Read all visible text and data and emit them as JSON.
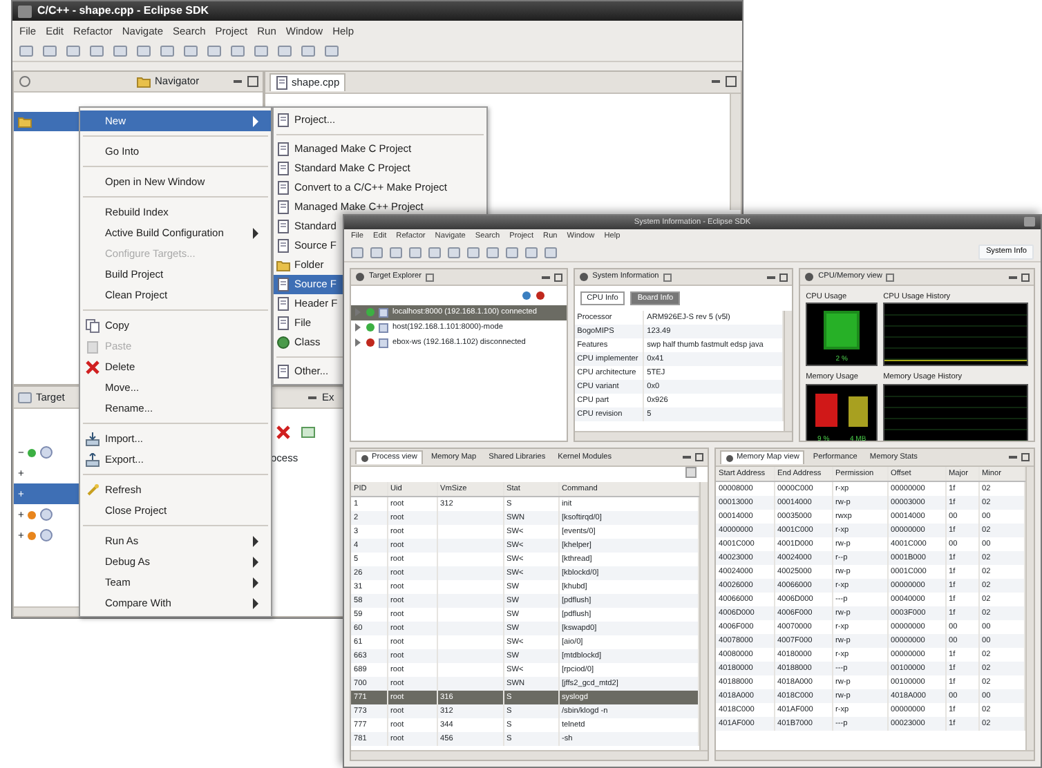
{
  "back_window": {
    "title": "C/C++ - shape.cpp - Eclipse SDK",
    "menu": [
      "File",
      "Edit",
      "Refactor",
      "Navigate",
      "Search",
      "Project",
      "Run",
      "Window",
      "Help"
    ],
    "navigator_tab": "Navigator",
    "editor_tab": "shape.cpp",
    "target_tab": "Target",
    "target_rows": [
      {
        "toggle": "−",
        "color": "#3cb043",
        "selected": false
      },
      {
        "toggle": "+",
        "selected": false
      },
      {
        "toggle": "+",
        "selected": true
      },
      {
        "toggle": "+",
        "color": "#e8851c",
        "selected": false
      },
      {
        "toggle": "+",
        "color": "#e8851c",
        "selected": false
      }
    ],
    "lower_tab": "Ex",
    "lower_text": "ocess"
  },
  "context_menu": [
    {
      "label": "New",
      "kind": "submenu",
      "selected": true,
      "disabled": false
    },
    {
      "kind": "separator"
    },
    {
      "label": "Go Into",
      "kind": "item",
      "selected": false,
      "disabled": false
    },
    {
      "kind": "separator"
    },
    {
      "label": "Open in New Window",
      "kind": "item",
      "selected": false,
      "disabled": false
    },
    {
      "kind": "separator"
    },
    {
      "label": "Rebuild Index",
      "kind": "item",
      "selected": false,
      "disabled": false
    },
    {
      "label": "Active Build Configuration",
      "kind": "submenu",
      "selected": false,
      "disabled": false
    },
    {
      "label": "Configure Targets...",
      "kind": "item",
      "selected": false,
      "disabled": true
    },
    {
      "label": "Build Project",
      "kind": "item",
      "selected": false,
      "disabled": false
    },
    {
      "label": "Clean Project",
      "kind": "item",
      "selected": false,
      "disabled": false
    },
    {
      "kind": "separator"
    },
    {
      "label": "Copy",
      "kind": "item",
      "selected": false,
      "disabled": false
    },
    {
      "label": "Paste",
      "kind": "item",
      "selected": false,
      "disabled": true
    },
    {
      "label": "Delete",
      "kind": "item",
      "selected": false,
      "disabled": false
    },
    {
      "label": "Move...",
      "kind": "item",
      "selected": false,
      "disabled": false
    },
    {
      "label": "Rename...",
      "kind": "item",
      "selected": false,
      "disabled": false
    },
    {
      "kind": "separator"
    },
    {
      "label": "Import...",
      "kind": "item",
      "selected": false,
      "disabled": false
    },
    {
      "label": "Export...",
      "kind": "item",
      "selected": false,
      "disabled": false
    },
    {
      "kind": "separator"
    },
    {
      "label": "Refresh",
      "kind": "item",
      "selected": false,
      "disabled": false
    },
    {
      "label": "Close Project",
      "kind": "item",
      "selected": false,
      "disabled": false
    },
    {
      "kind": "separator"
    },
    {
      "label": "Run As",
      "kind": "submenu",
      "selected": false,
      "disabled": false
    },
    {
      "label": "Debug As",
      "kind": "submenu",
      "selected": false,
      "disabled": false
    },
    {
      "label": "Team",
      "kind": "submenu",
      "selected": false,
      "disabled": false
    },
    {
      "label": "Compare With",
      "kind": "submenu",
      "selected": false,
      "disabled": false
    }
  ],
  "submenu": [
    {
      "label": "Project...",
      "kind": "item",
      "selected": false
    },
    {
      "kind": "separator"
    },
    {
      "label": "Managed Make C Project",
      "kind": "item",
      "selected": false
    },
    {
      "label": "Standard Make C Project",
      "kind": "item",
      "selected": false
    },
    {
      "label": "Convert to a C/C++ Make Project",
      "kind": "item",
      "selected": false
    },
    {
      "label": "Managed Make C++ Project",
      "kind": "item",
      "selected": false
    },
    {
      "label": "Standard",
      "kind": "item",
      "selected": false
    },
    {
      "label": "Source F",
      "kind": "item",
      "selected": false
    },
    {
      "label": "Folder",
      "kind": "item",
      "selected": false
    },
    {
      "label": "Source F",
      "kind": "item",
      "selected": true
    },
    {
      "label": "Header F",
      "kind": "item",
      "selected": false
    },
    {
      "label": "File",
      "kind": "item",
      "selected": false
    },
    {
      "label": "Class",
      "kind": "item",
      "selected": false
    },
    {
      "kind": "separator"
    },
    {
      "label": "Other...",
      "kind": "item",
      "selected": false
    }
  ],
  "front_window": {
    "title": "System Information - Eclipse SDK",
    "menu": [
      "File",
      "Edit",
      "Refactor",
      "Navigate",
      "Search",
      "Project",
      "Run",
      "Window",
      "Help"
    ],
    "perspective_button": "System Info",
    "target_explorer": {
      "title": "Target Explorer",
      "rows": [
        {
          "label": "localhost:8000 (192.168.1.100) connected",
          "color": "#3cb043",
          "selected": true
        },
        {
          "label": "host(192.168.1.101:8000)-mode",
          "color": "#3cb043",
          "selected": false
        },
        {
          "label": "ebox-ws (192.168.1.102) disconnected",
          "color": "#c0281e",
          "selected": false
        }
      ]
    },
    "system_information": {
      "title": "System Information",
      "tabs": [
        {
          "label": "CPU Info",
          "selected": true
        },
        {
          "label": "Board Info",
          "selected": false
        }
      ],
      "rows": [
        [
          "Processor",
          "ARM926EJ-S rev 5 (v5l)"
        ],
        [
          "BogoMIPS",
          "123.49"
        ],
        [
          "Features",
          "swp half thumb fastmult edsp java"
        ],
        [
          "CPU implementer",
          "0x41"
        ],
        [
          "CPU architecture",
          "5TEJ"
        ],
        [
          "CPU variant",
          "0x0"
        ],
        [
          "CPU part",
          "0x926"
        ],
        [
          "CPU revision",
          "5"
        ]
      ]
    },
    "cpu_memory": {
      "title": "CPU/Memory view",
      "charts": [
        {
          "label": "CPU Usage",
          "kind": "cpu",
          "readings": [
            "2 %"
          ]
        },
        {
          "label": "CPU Usage History",
          "kind": "history"
        },
        {
          "label": "Memory Usage",
          "kind": "memory",
          "readings": [
            "9 %",
            "4 MB"
          ]
        },
        {
          "label": "Memory Usage History",
          "kind": "history"
        }
      ]
    },
    "process_view": {
      "tabs": [
        {
          "label": "Process view",
          "selected": true
        },
        {
          "label": "Memory Map",
          "selected": false
        },
        {
          "label": "Shared Libraries",
          "selected": false
        },
        {
          "label": "Kernel Modules",
          "selected": false
        }
      ],
      "columns": [
        "PID",
        "Uid",
        "VmSize",
        "Stat",
        "Command"
      ],
      "rows": [
        {
          "cells": [
            "1",
            "root",
            "312",
            "S",
            "init"
          ],
          "selected": false
        },
        {
          "cells": [
            "2",
            "root",
            "",
            "SWN",
            "[ksoftirqd/0]"
          ],
          "selected": false
        },
        {
          "cells": [
            "3",
            "root",
            "",
            "SW<",
            "[events/0]"
          ],
          "selected": false
        },
        {
          "cells": [
            "4",
            "root",
            "",
            "SW<",
            "[khelper]"
          ],
          "selected": false
        },
        {
          "cells": [
            "5",
            "root",
            "",
            "SW<",
            "[kthread]"
          ],
          "selected": false
        },
        {
          "cells": [
            "26",
            "root",
            "",
            "SW<",
            "[kblockd/0]"
          ],
          "selected": false
        },
        {
          "cells": [
            "31",
            "root",
            "",
            "SW",
            "[khubd]"
          ],
          "selected": false
        },
        {
          "cells": [
            "58",
            "root",
            "",
            "SW",
            "[pdflush]"
          ],
          "selected": false
        },
        {
          "cells": [
            "59",
            "root",
            "",
            "SW",
            "[pdflush]"
          ],
          "selected": false
        },
        {
          "cells": [
            "60",
            "root",
            "",
            "SW",
            "[kswapd0]"
          ],
          "selected": false
        },
        {
          "cells": [
            "61",
            "root",
            "",
            "SW<",
            "[aio/0]"
          ],
          "selected": false
        },
        {
          "cells": [
            "663",
            "root",
            "",
            "SW",
            "[mtdblockd]"
          ],
          "selected": false
        },
        {
          "cells": [
            "689",
            "root",
            "",
            "SW<",
            "[rpciod/0]"
          ],
          "selected": false
        },
        {
          "cells": [
            "700",
            "root",
            "",
            "SWN",
            "[jffs2_gcd_mtd2]"
          ],
          "selected": false
        },
        {
          "cells": [
            "771",
            "root",
            "316",
            "S",
            "syslogd"
          ],
          "selected": true
        },
        {
          "cells": [
            "773",
            "root",
            "312",
            "S",
            "/sbin/klogd -n"
          ],
          "selected": false
        },
        {
          "cells": [
            "777",
            "root",
            "344",
            "S",
            "telnetd"
          ],
          "selected": false
        },
        {
          "cells": [
            "781",
            "root",
            "456",
            "S",
            "-sh"
          ],
          "selected": false
        }
      ]
    },
    "memory_view": {
      "tabs": [
        {
          "label": "Memory Map view",
          "selected": true
        },
        {
          "label": "Performance",
          "selected": false
        },
        {
          "label": "Memory Stats",
          "selected": false
        }
      ],
      "columns": [
        "Start Address",
        "End Address",
        "Permission",
        "Offset",
        "Major",
        "Minor"
      ],
      "rows": [
        [
          "00008000",
          "0000C000",
          "r-xp",
          "00000000",
          "1f",
          "02"
        ],
        [
          "00013000",
          "00014000",
          "rw-p",
          "00003000",
          "1f",
          "02"
        ],
        [
          "00014000",
          "00035000",
          "rwxp",
          "00014000",
          "00",
          "00"
        ],
        [
          "40000000",
          "4001C000",
          "r-xp",
          "00000000",
          "1f",
          "02"
        ],
        [
          "4001C000",
          "4001D000",
          "rw-p",
          "4001C000",
          "00",
          "00"
        ],
        [
          "40023000",
          "40024000",
          "r--p",
          "0001B000",
          "1f",
          "02"
        ],
        [
          "40024000",
          "40025000",
          "rw-p",
          "0001C000",
          "1f",
          "02"
        ],
        [
          "40026000",
          "40066000",
          "r-xp",
          "00000000",
          "1f",
          "02"
        ],
        [
          "40066000",
          "4006D000",
          "---p",
          "00040000",
          "1f",
          "02"
        ],
        [
          "4006D000",
          "4006F000",
          "rw-p",
          "0003F000",
          "1f",
          "02"
        ],
        [
          "4006F000",
          "40070000",
          "r-xp",
          "00000000",
          "00",
          "00"
        ],
        [
          "40078000",
          "4007F000",
          "rw-p",
          "00000000",
          "00",
          "00"
        ],
        [
          "40080000",
          "40180000",
          "r-xp",
          "00000000",
          "1f",
          "02"
        ],
        [
          "40180000",
          "40188000",
          "---p",
          "00100000",
          "1f",
          "02"
        ],
        [
          "40188000",
          "4018A000",
          "rw-p",
          "00100000",
          "1f",
          "02"
        ],
        [
          "4018A000",
          "4018C000",
          "rw-p",
          "4018A000",
          "00",
          "00"
        ],
        [
          "4018C000",
          "401AF000",
          "r-xp",
          "00000000",
          "1f",
          "02"
        ],
        [
          "401AF000",
          "401B7000",
          "---p",
          "00023000",
          "1f",
          "02"
        ]
      ]
    }
  }
}
